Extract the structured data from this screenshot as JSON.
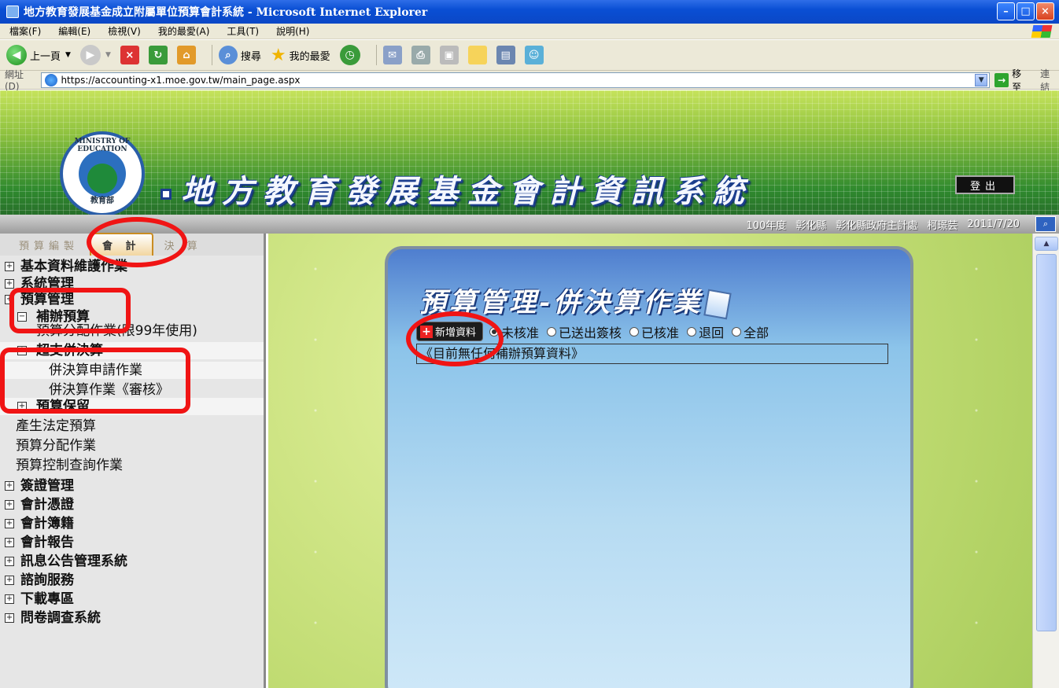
{
  "window": {
    "title": "地方教育發展基金成立附屬單位預算會計系統 - Microsoft Internet Explorer",
    "minimize": "–",
    "maximize": "□",
    "close": "×"
  },
  "menubar": [
    "檔案(F)",
    "編輯(E)",
    "檢視(V)",
    "我的最愛(A)",
    "工具(T)",
    "說明(H)"
  ],
  "toolbar": {
    "back_label": "上一頁",
    "search_label": "搜尋",
    "favorites_label": "我的最愛"
  },
  "address": {
    "label": "網址(D)",
    "url": "https://accounting-x1.moe.gov.tw/main_page.aspx",
    "go_label": "移至",
    "links_label": "連結"
  },
  "banner": {
    "logo_text": "MINISTRY OF EDUCATION",
    "logo_sub": "教育部",
    "title": "地方教育發展基金會計資訊系統",
    "logout_label": "登出"
  },
  "infostrip": {
    "year": "100年度",
    "county": "彰化縣",
    "office": "彰化縣政府主計處",
    "user": "柯璟芸",
    "date": "2011/7/20"
  },
  "sidebar": {
    "tabs": [
      "預算編製",
      "會 計",
      "決 算"
    ],
    "items": [
      {
        "label": "基本資料維護作業"
      },
      {
        "label": "系統管理"
      },
      {
        "label": "預算管理"
      },
      {
        "label": "補辦預算"
      },
      {
        "label": "預算分配作業(限99年使用)"
      },
      {
        "label": "超支併決算"
      },
      {
        "label": "併決算申請作業"
      },
      {
        "label": "併決算作業《審核》"
      },
      {
        "label": "預算保留"
      },
      {
        "label": "產生法定預算"
      },
      {
        "label": "預算分配作業"
      },
      {
        "label": "預算控制查詢作業"
      },
      {
        "label": "簽證管理"
      },
      {
        "label": "會計憑證"
      },
      {
        "label": "會計簿籍"
      },
      {
        "label": "會計報告"
      },
      {
        "label": "訊息公告管理系統"
      },
      {
        "label": "諮詢服務"
      },
      {
        "label": "下載專區"
      },
      {
        "label": "問卷調查系統"
      }
    ]
  },
  "main": {
    "title": "預算管理-併決算作業",
    "add_button": "新增資料",
    "filters": [
      "未核准",
      "已送出簽核",
      "已核准",
      "退回",
      "全部"
    ],
    "selected_filter": "未核准",
    "empty_message": "《目前無任何補辦預算資料》"
  }
}
